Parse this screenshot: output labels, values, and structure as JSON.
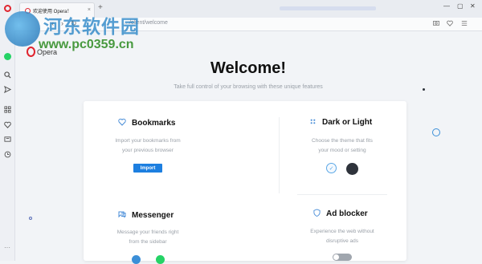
{
  "tab": {
    "title": "欢迎使用 Opera！",
    "close": "×"
  },
  "titlebar": {
    "newtab": "+",
    "minimize": "—",
    "maximize": "▢",
    "close": "✕"
  },
  "address": {
    "back": "‹",
    "forward": "›",
    "reload": "↻",
    "home": "⌂",
    "url": "…/client/welcome"
  },
  "watermark": {
    "title": "河东软件园",
    "url": "www.pc0359.cn"
  },
  "brand": {
    "name": "Opera"
  },
  "hero": {
    "title": "Welcome!",
    "subtitle": "Take full control of your browsing with these unique features"
  },
  "features": {
    "bookmarks": {
      "title": "Bookmarks",
      "desc1": "Import your bookmarks from",
      "desc2": "your previous browser",
      "button": "Import"
    },
    "theme": {
      "title": "Dark or Light",
      "desc1": "Choose the theme that fits",
      "desc2": "your mood or setting",
      "check": "✓"
    },
    "messenger": {
      "title": "Messenger",
      "desc1": "Message your friends right",
      "desc2": "from the sidebar"
    },
    "adblocker": {
      "title": "Ad blocker",
      "desc1": "Experience the web without",
      "desc2": "disruptive ads"
    }
  },
  "sidebar": {
    "more": "···"
  },
  "icons": [
    "opera-icon",
    "whatsapp-icon",
    "search-icon",
    "send-icon",
    "grid-icon",
    "heart-icon",
    "news-icon",
    "history-icon",
    "camera-icon",
    "heart-icon",
    "menu-icon"
  ],
  "colors": {
    "accent": "#1d7fe0",
    "opera_red": "#e0252f",
    "dark_theme": "#2e333b",
    "whatsapp": "#25d366"
  }
}
